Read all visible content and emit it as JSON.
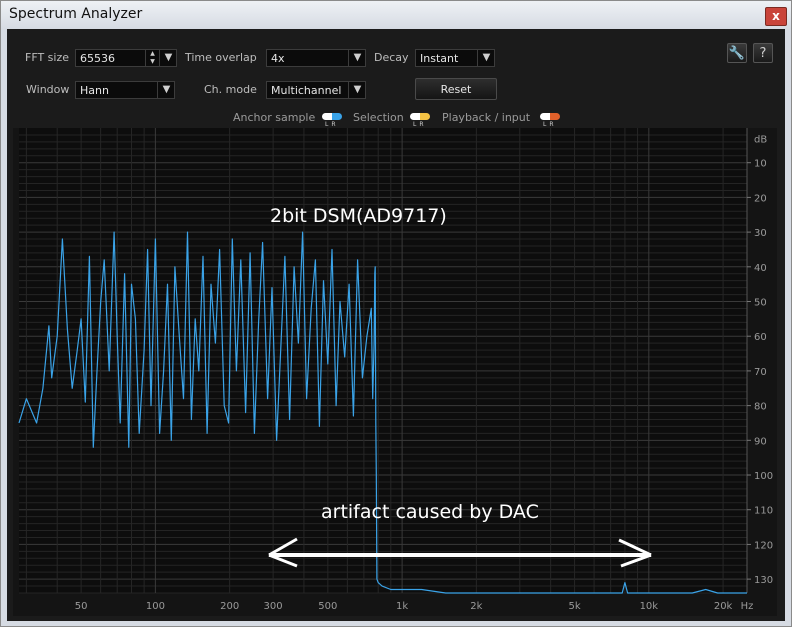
{
  "window": {
    "title": "Spectrum Analyzer",
    "close_label": "x"
  },
  "controls": {
    "fft_size": {
      "label": "FFT size",
      "value": "65536"
    },
    "time_overlap": {
      "label": "Time overlap",
      "value": "4x"
    },
    "decay": {
      "label": "Decay",
      "value": "Instant"
    },
    "window_fn": {
      "label": "Window",
      "value": "Hann"
    },
    "ch_mode": {
      "label": "Ch. mode",
      "value": "Multichannel"
    },
    "reset_label": "Reset",
    "settings_icon": "wrench-icon",
    "help_label": "?"
  },
  "legend": {
    "anchor": {
      "label": "Anchor sample",
      "l": "L",
      "r": "R",
      "color_l": "#ffffff",
      "color_r": "#3aa3e8"
    },
    "selection": {
      "label": "Selection",
      "l": "L",
      "r": "R",
      "color_l": "#ffffff",
      "color_r": "#f4c244"
    },
    "playback": {
      "label": "Playback / input",
      "l": "L",
      "r": "R",
      "color_l": "#ffffff",
      "color_r": "#e0602a"
    }
  },
  "annotations": {
    "title": "2bit DSM(AD9717)",
    "artifact": "artifact caused by DAC"
  },
  "chart_data": {
    "type": "line",
    "x_scale": "log",
    "xlim": [
      28,
      25000
    ],
    "ylim": [
      -134,
      0
    ],
    "x_ticks": [
      {
        "v": 50,
        "label": "50"
      },
      {
        "v": 100,
        "label": "100"
      },
      {
        "v": 200,
        "label": "200"
      },
      {
        "v": 300,
        "label": "300"
      },
      {
        "v": 500,
        "label": "500"
      },
      {
        "v": 1000,
        "label": "1k"
      },
      {
        "v": 2000,
        "label": "2k"
      },
      {
        "v": 5000,
        "label": "5k"
      },
      {
        "v": 10000,
        "label": "10k"
      },
      {
        "v": 20000,
        "label": "20k"
      }
    ],
    "x_unit": "Hz",
    "y_unit": "dB",
    "y_ticks": [
      {
        "v": -10,
        "label": "10"
      },
      {
        "v": -20,
        "label": "20"
      },
      {
        "v": -30,
        "label": "30"
      },
      {
        "v": -40,
        "label": "40"
      },
      {
        "v": -50,
        "label": "50"
      },
      {
        "v": -60,
        "label": "60"
      },
      {
        "v": -70,
        "label": "70"
      },
      {
        "v": -80,
        "label": "80"
      },
      {
        "v": -90,
        "label": "90"
      },
      {
        "v": -100,
        "label": "100"
      },
      {
        "v": -110,
        "label": "110"
      },
      {
        "v": -120,
        "label": "120"
      },
      {
        "v": -130,
        "label": "130"
      }
    ],
    "grid": true,
    "line_color": "#3aa3e8",
    "series": [
      {
        "x": [
          28,
          30,
          33,
          35,
          37,
          38,
          40,
          42,
          44,
          46,
          48,
          50,
          52,
          54,
          56,
          58,
          60,
          62,
          65,
          68,
          70,
          72,
          75,
          78,
          80,
          83,
          86,
          90,
          93,
          96,
          100,
          104,
          108,
          112,
          116,
          120,
          125,
          130,
          135,
          140,
          145,
          150,
          156,
          162,
          168,
          175,
          182,
          190,
          198,
          205,
          213,
          222,
          232,
          242,
          252,
          262,
          272,
          285,
          297,
          310,
          322,
          335,
          350,
          365,
          380,
          395,
          410,
          428,
          445,
          462,
          480,
          500,
          520,
          540,
          560,
          585,
          610,
          635,
          660,
          690,
          720,
          750,
          760,
          770,
          775,
          778,
          782,
          786,
          790,
          800,
          830,
          900,
          1000,
          1200,
          1500,
          2000,
          3000,
          4000,
          5000,
          6000,
          7000,
          7800,
          8000,
          8200,
          9000,
          10000,
          12000,
          15000,
          17000,
          19000,
          20000,
          21000,
          22000,
          23000,
          25000
        ],
        "y": [
          -85,
          -78,
          -85,
          -75,
          -57,
          -72,
          -60,
          -32,
          -58,
          -75,
          -65,
          -55,
          -79,
          -37,
          -92,
          -70,
          -50,
          -38,
          -70,
          -30,
          -60,
          -85,
          -42,
          -92,
          -45,
          -55,
          -88,
          -64,
          -35,
          -80,
          -32,
          -88,
          -70,
          -45,
          -90,
          -40,
          -60,
          -78,
          -30,
          -84,
          -55,
          -70,
          -37,
          -88,
          -45,
          -62,
          -35,
          -80,
          -85,
          -32,
          -70,
          -38,
          -82,
          -36,
          -88,
          -56,
          -33,
          -78,
          -46,
          -90,
          -64,
          -37,
          -84,
          -40,
          -62,
          -30,
          -78,
          -52,
          -38,
          -86,
          -44,
          -68,
          -35,
          -80,
          -50,
          -66,
          -45,
          -83,
          -38,
          -72,
          -60,
          -52,
          -78,
          -62,
          -42,
          -40,
          -85,
          -100,
          -130,
          -131,
          -132,
          -133,
          -133,
          -133,
          -134,
          -134,
          -134,
          -134,
          -134,
          -134,
          -134,
          -134,
          -131,
          -134,
          -134,
          -134,
          -134,
          -134,
          -133,
          -134,
          -134,
          -134,
          -134,
          -134,
          -134
        ]
      }
    ]
  }
}
